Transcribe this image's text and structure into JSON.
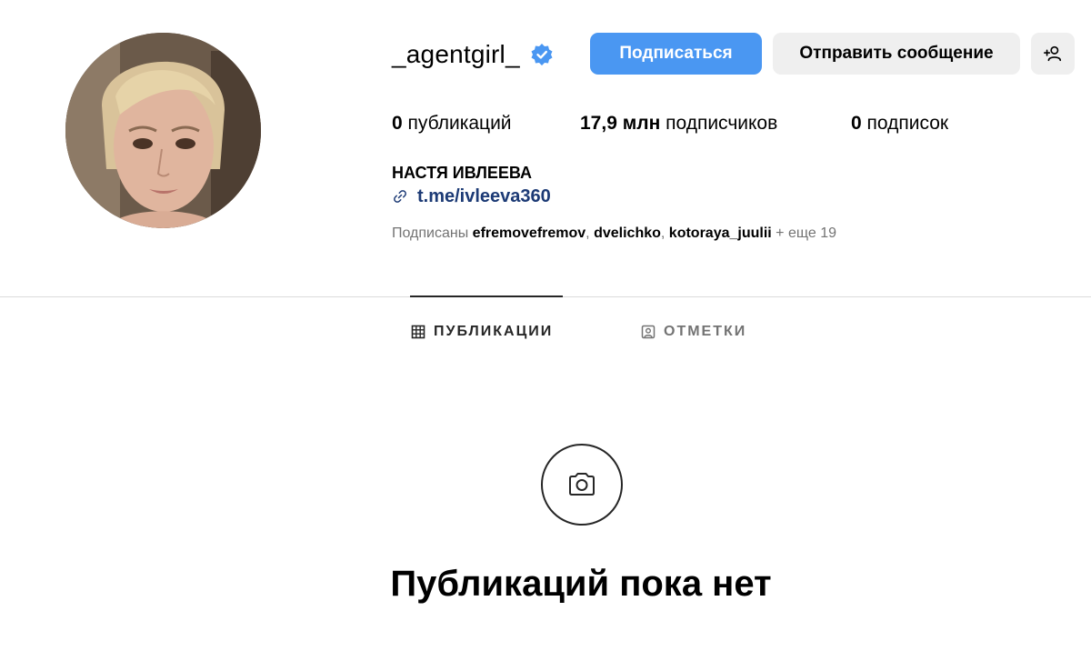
{
  "profile": {
    "username": "_agentgirl_",
    "full_name": "НАСТЯ ИВЛЕЕВА",
    "link": "t.me/ivleeva360",
    "avatar_icon": "profile-photo",
    "verified_icon": "verified-badge-icon",
    "verified_color": "#4a97f2"
  },
  "buttons": {
    "follow_label": "Подписаться",
    "message_label": "Отправить сообщение",
    "add_user_icon": "add-person-icon"
  },
  "stats": {
    "posts_count": "0",
    "posts_label": "публикаций",
    "followers_count": "17,9 млн",
    "followers_label": "подписчиков",
    "following_count": "0",
    "following_label": "подписок"
  },
  "followed_by": {
    "prefix": "Подписаны",
    "accounts": [
      "efremovefremov",
      "dvelichko",
      "kotoraya_juulii"
    ],
    "suffix": "+ еще 19"
  },
  "tabs": [
    {
      "label": "ПУБЛИКАЦИИ",
      "icon": "grid-icon",
      "active": true
    },
    {
      "label": "ОТМЕТКИ",
      "icon": "tagged-icon",
      "active": false
    }
  ],
  "empty_state": {
    "icon": "camera-icon",
    "title": "Публикаций пока нет"
  },
  "colors": {
    "primary_button": "#4a97f2",
    "secondary_button": "#efefef",
    "link": "#1c3a75",
    "muted_text": "#737373"
  }
}
